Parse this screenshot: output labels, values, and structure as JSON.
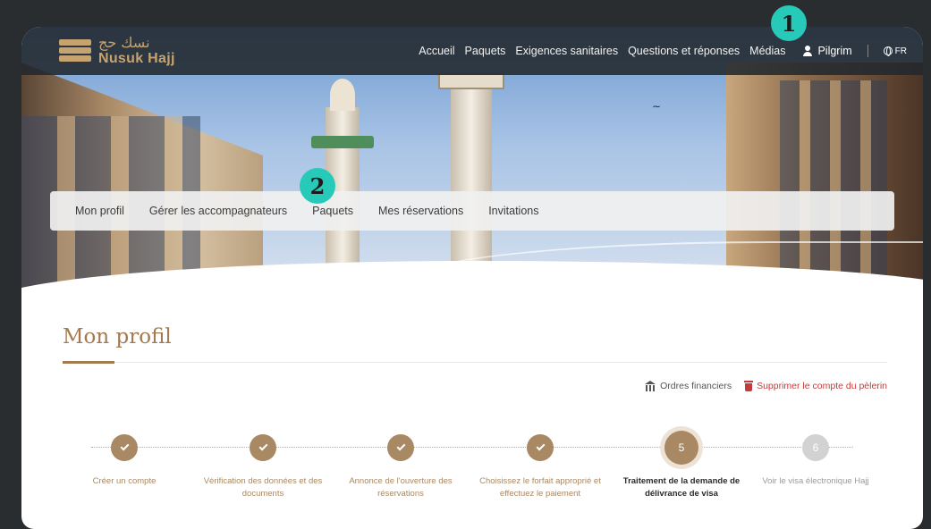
{
  "brand": {
    "name_ar": "نسك حج",
    "name_en": "Nusuk Hajj"
  },
  "topnav": {
    "links": [
      "Accueil",
      "Paquets",
      "Exigences sanitaires",
      "Questions et réponses",
      "Médias"
    ],
    "user": "Pilgrim",
    "lang": "FR"
  },
  "subnav": {
    "items": [
      "Mon profil",
      "Gérer les accompagnateurs",
      "Paquets",
      "Mes réservations",
      "Invitations"
    ]
  },
  "badges": [
    "1",
    "2"
  ],
  "page": {
    "title": "Mon profil",
    "actions": {
      "financial_orders": "Ordres financiers",
      "delete_account": "Supprimer le compte du pèlerin"
    }
  },
  "steps": [
    {
      "label": "Créer un compte",
      "state": "done"
    },
    {
      "label": "Vérification des données et des documents",
      "state": "done"
    },
    {
      "label": "Annonce de l'ouverture des réservations",
      "state": "done"
    },
    {
      "label": "Choisissez le forfait approprié et effectuez le paiement",
      "state": "done"
    },
    {
      "number": "5",
      "label": "Traitement de la demande de délivrance de visa",
      "state": "current"
    },
    {
      "number": "6",
      "label": "Voir le visa électronique Hajj",
      "state": "future"
    }
  ],
  "colors": {
    "accent": "#a88963",
    "title": "#a47a4f",
    "badge": "#27c9b9",
    "danger": "#c53a3a"
  }
}
